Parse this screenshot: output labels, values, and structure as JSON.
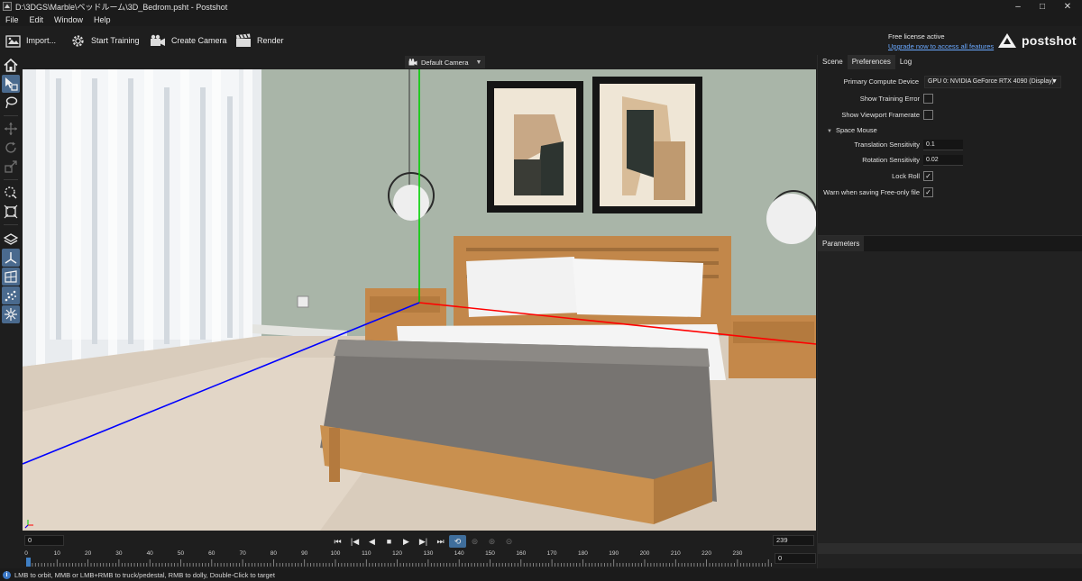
{
  "window": {
    "title": "D:\\3DGS\\Marble\\ベッドルーム\\3D_Bedrom.psht - Postshot",
    "controls": [
      "–",
      "□",
      "✕"
    ]
  },
  "menu": [
    "File",
    "Edit",
    "Window",
    "Help"
  ],
  "toolbar": {
    "import": "Import...",
    "start_training": "Start Training",
    "create_camera": "Create Camera",
    "render": "Render"
  },
  "license": {
    "status": "Free license active",
    "upgrade_link": "Upgrade now to access all features"
  },
  "brand": "postshot",
  "viewport": {
    "camera": "Default Camera"
  },
  "timeline": {
    "current_frame": "0",
    "end_frame": "239",
    "range_end": "0",
    "ticks": [
      "0",
      "10",
      "20",
      "30",
      "40",
      "50",
      "60",
      "70",
      "80",
      "90",
      "100",
      "110",
      "120",
      "130",
      "140",
      "150",
      "160",
      "170",
      "180",
      "190",
      "200",
      "210",
      "220",
      "230"
    ]
  },
  "panel": {
    "tabs": [
      "Scene",
      "Preferences",
      "Log"
    ],
    "active_tab": "Preferences",
    "primary_compute_label": "Primary Compute Device",
    "primary_compute_value": "GPU 0: NVIDIA GeForce RTX 4090 (Display)",
    "show_training_error": "Show Training Error",
    "show_viewport_framerate": "Show Viewport Framerate",
    "space_mouse": "Space Mouse",
    "translation_sensitivity_label": "Translation Sensitivity",
    "translation_sensitivity_value": "0.1",
    "rotation_sensitivity_label": "Rotation Sensitivity",
    "rotation_sensitivity_value": "0.02",
    "lock_roll": "Lock Roll",
    "warn_free_only": "Warn when saving Free-only file",
    "parameters_tab": "Parameters"
  },
  "status": {
    "message": "LMB to orbit, MMB or LMB+RMB to truck/pedestal, RMB to dolly, Double-Click to target"
  },
  "colors": {
    "accent": "#3f7fc4",
    "active_tool": "#4a6a8e",
    "axis_x": "#ff0000",
    "axis_y": "#00d000",
    "axis_z": "#0000ff"
  }
}
